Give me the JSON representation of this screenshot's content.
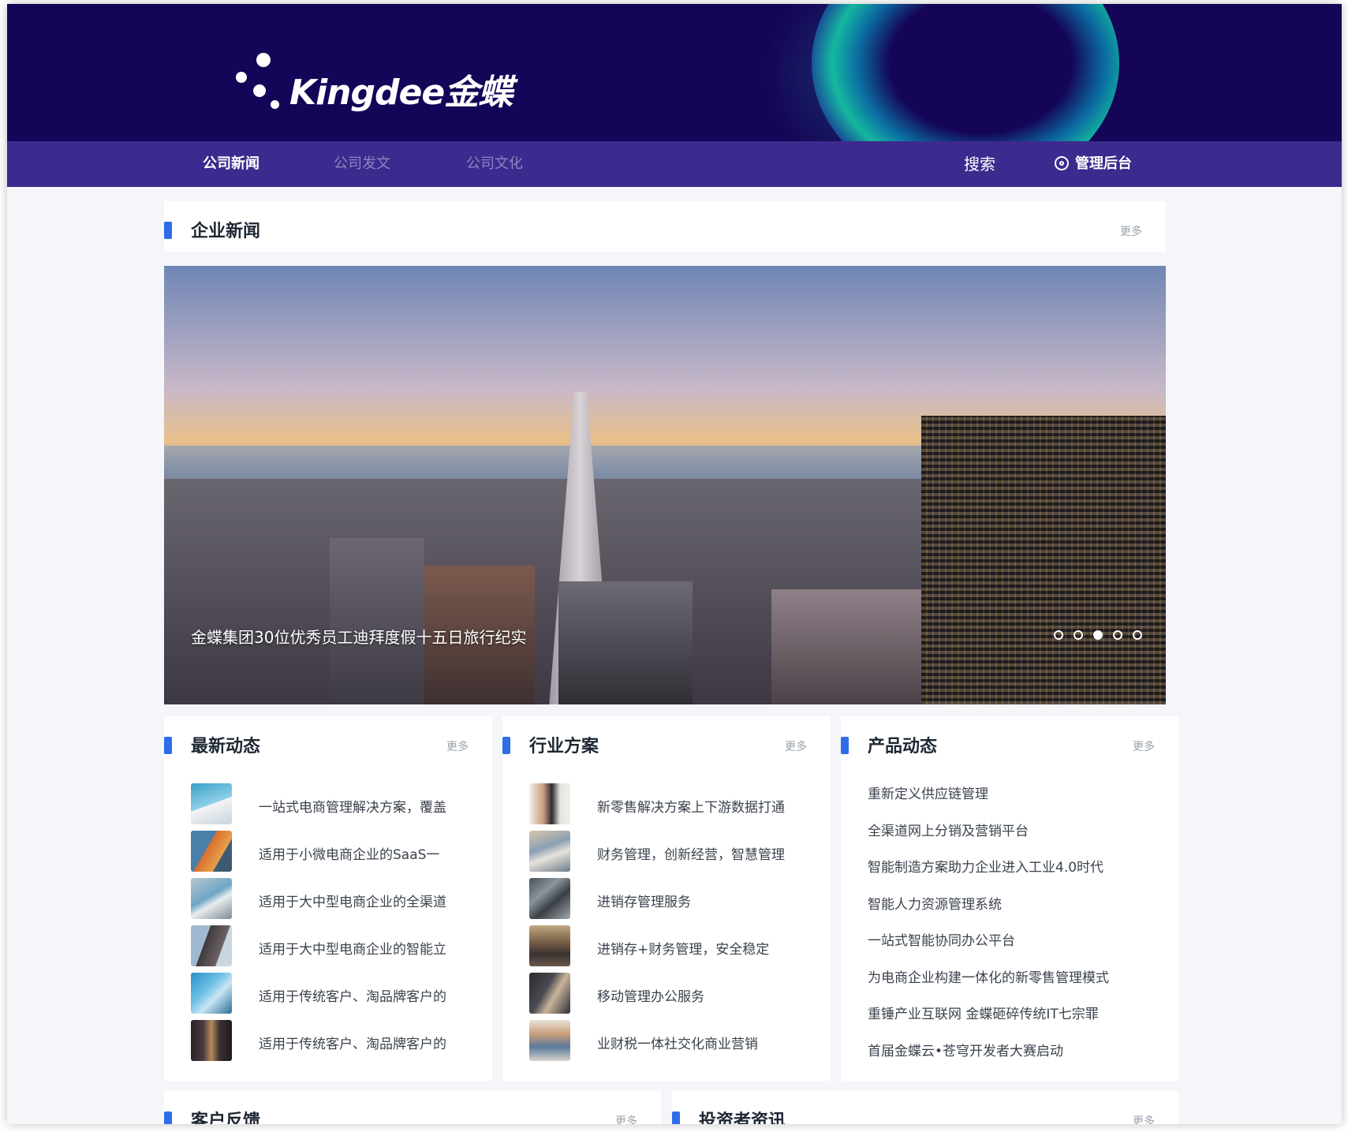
{
  "header": {
    "logo_text": "Kingdee金蝶",
    "nav": [
      "公司新闻",
      "公司发文",
      "公司文化"
    ],
    "search_label": "搜索",
    "admin_label": "管理后台"
  },
  "enterprise_news": {
    "title": "企业新闻",
    "more": "更多",
    "caption": "金蝶集团30位优秀员工迪拜度假十五日旅行纪实"
  },
  "latest": {
    "title": "最新动态",
    "more": "更多",
    "items": [
      {
        "text": "一站式电商管理解决方案，覆盖"
      },
      {
        "text": "适用于小微电商企业的SaaS一"
      },
      {
        "text": "适用于大中型电商企业的全渠道"
      },
      {
        "text": "适用于大中型电商企业的智能立"
      },
      {
        "text": "适用于传统客户、淘品牌客户的"
      },
      {
        "text": "适用于传统客户、淘品牌客户的"
      }
    ]
  },
  "industry": {
    "title": "行业方案",
    "more": "更多",
    "items": [
      {
        "text": "新零售解决方案上下游数据打通"
      },
      {
        "text": "财务管理，创新经营，智慧管理"
      },
      {
        "text": "进销存管理服务"
      },
      {
        "text": "进销存+财务管理，安全稳定"
      },
      {
        "text": "移动管理办公服务"
      },
      {
        "text": "业财税一体社交化商业营销"
      }
    ]
  },
  "product": {
    "title": "产品动态",
    "more": "更多",
    "items": [
      "重新定义供应链管理",
      "全渠道网上分销及营销平台",
      "智能制造方案助力企业进入工业4.0时代",
      "智能人力资源管理系统",
      "一站式智能协同办公平台",
      "为电商企业构建一体化的新零售管理模式",
      "重锤产业互联网 金蝶砸碎传统IT七宗罪",
      "首届金蝶云•苍穹开发者大赛启动"
    ]
  },
  "bottom": {
    "left_title": "客户反馈",
    "left_more": "更多",
    "right_title": "投资者资讯",
    "right_more": "更多"
  },
  "colors": {
    "banner": "#150558",
    "nav": "#3d2a8e",
    "accent": "#2f6ce8"
  }
}
